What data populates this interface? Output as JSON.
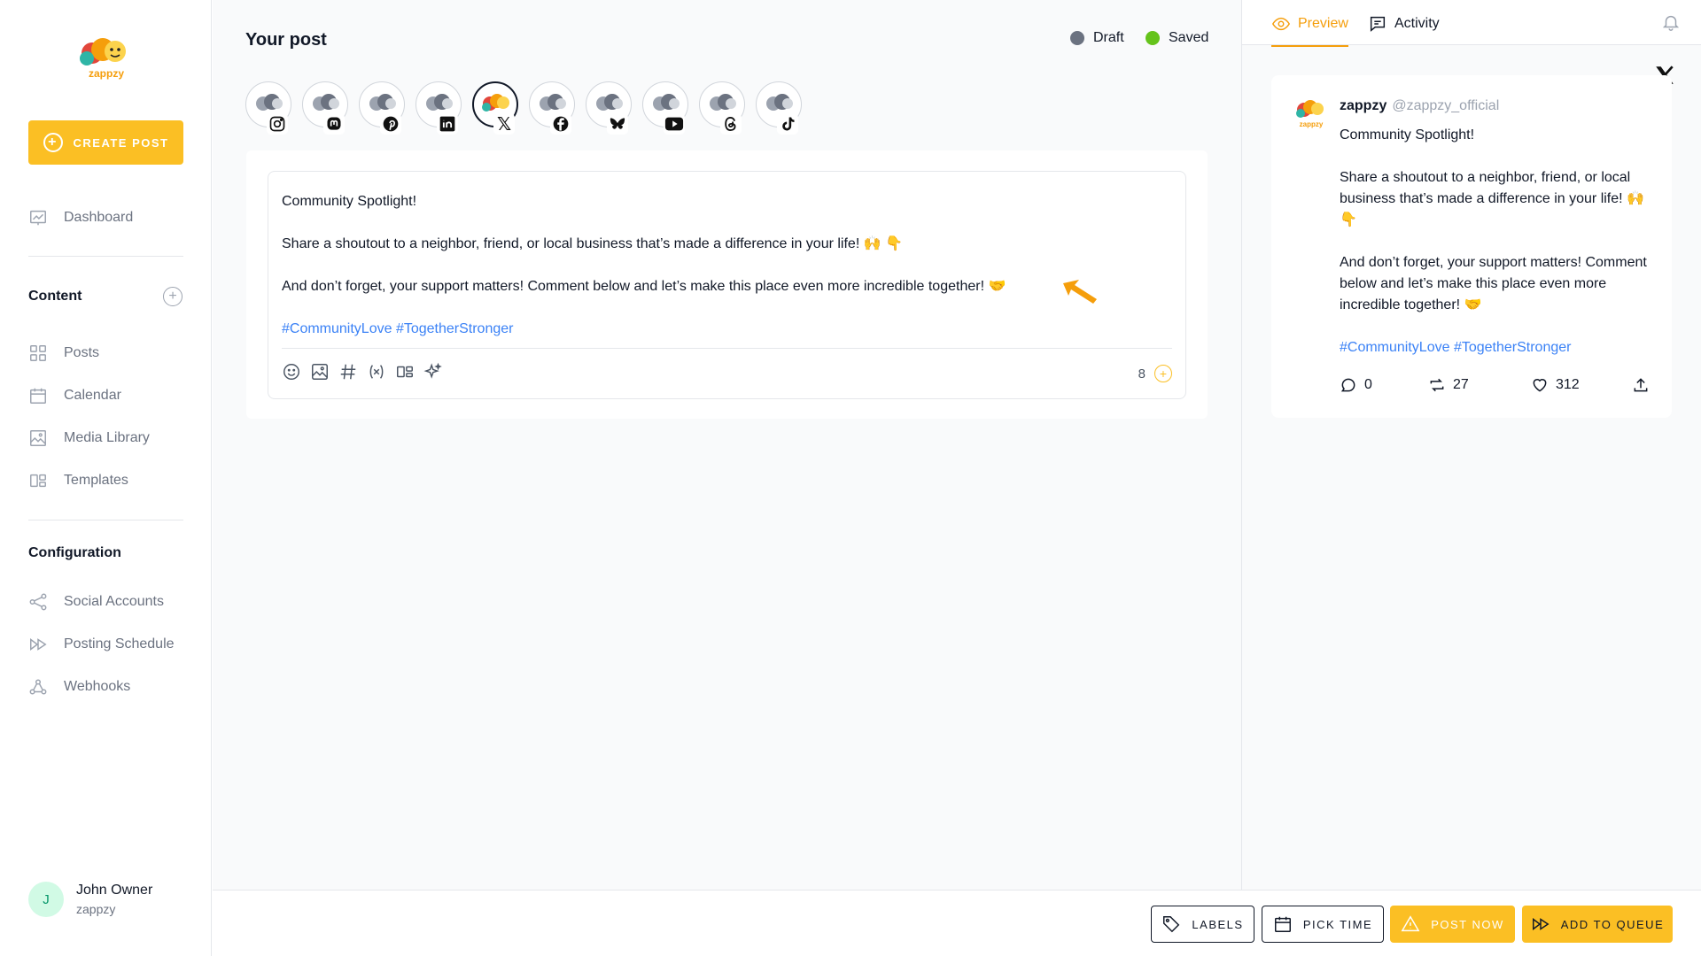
{
  "brand": {
    "name": "zappzy",
    "accent": "#fbbf24"
  },
  "sidebar": {
    "create_label": "CREATE POST",
    "nav_top": [
      {
        "label": "Dashboard",
        "icon": "chart-icon"
      }
    ],
    "content_title": "Content",
    "content_items": [
      {
        "label": "Posts",
        "icon": "grid-icon"
      },
      {
        "label": "Calendar",
        "icon": "calendar-icon"
      },
      {
        "label": "Media Library",
        "icon": "image-icon"
      },
      {
        "label": "Templates",
        "icon": "templates-icon"
      }
    ],
    "config_title": "Configuration",
    "config_items": [
      {
        "label": "Social Accounts",
        "icon": "share-icon"
      },
      {
        "label": "Posting Schedule",
        "icon": "forward-icon"
      },
      {
        "label": "Webhooks",
        "icon": "webhook-icon"
      }
    ],
    "user": {
      "initial": "J",
      "name": "John Owner",
      "org": "zappzy"
    }
  },
  "main": {
    "title": "Your post",
    "status": [
      {
        "label": "Draft",
        "color": "#6b7280"
      },
      {
        "label": "Saved",
        "color": "#65c31b"
      }
    ],
    "channels": [
      "instagram",
      "mastodon",
      "pinterest",
      "linkedin",
      "x",
      "facebook",
      "bluesky",
      "youtube",
      "threads",
      "tiktok"
    ],
    "active_channel": "x",
    "editor": {
      "line1": "Community Spotlight!",
      "line2": "Share a shoutout to a neighbor, friend, or local business that’s made a difference in your life! 🙌 👇",
      "line3": "And don’t forget, your support matters! Comment below and let’s make this place even more incredible together! 🤝",
      "hashtags": "#CommunityLove #TogetherStronger",
      "char_count": "8"
    }
  },
  "preview": {
    "tabs": [
      {
        "label": "Preview"
      },
      {
        "label": "Activity"
      }
    ],
    "account_name": "zappzy",
    "account_handle": "@zappzy_official",
    "p1": "Community Spotlight!",
    "p2": "Share a shoutout to a neighbor, friend, or local business that’s made a difference in your life! 🙌 👇",
    "p3": "And don’t forget, your support matters! Comment below and let’s make this place even more incredible together! 🤝",
    "hashtags": "#CommunityLove #TogetherStronger",
    "replies": "0",
    "reposts": "27",
    "likes": "312"
  },
  "bottom": {
    "labels": "LABELS",
    "pick_time": "PICK TIME",
    "post_now": "POST NOW",
    "add_queue": "ADD TO QUEUE"
  }
}
